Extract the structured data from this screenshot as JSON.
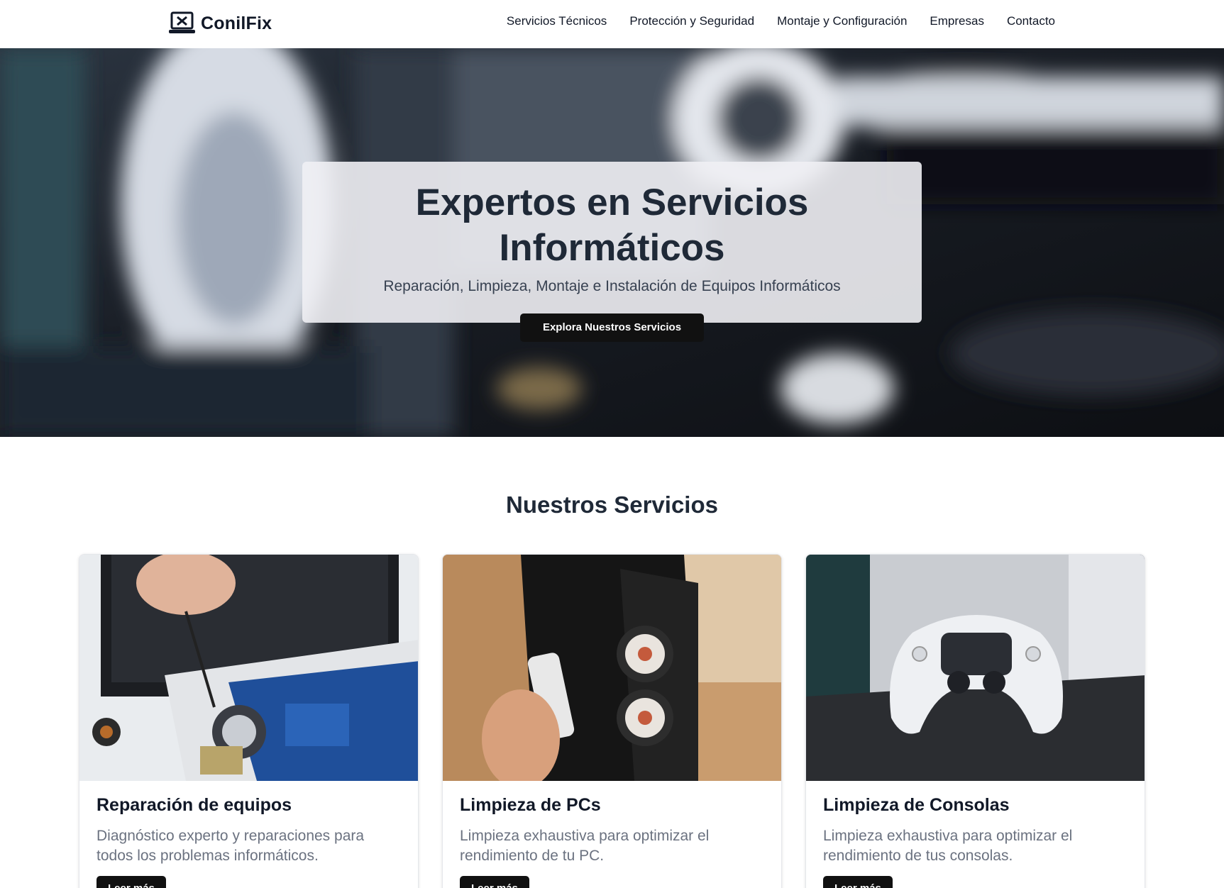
{
  "header": {
    "brand": "ConilFix",
    "brand_icon": "laptop-icon",
    "nav": [
      {
        "label": "Servicios Técnicos"
      },
      {
        "label": "Protección y Seguridad"
      },
      {
        "label": "Montaje y Configuración"
      },
      {
        "label": "Empresas"
      },
      {
        "label": "Contacto"
      }
    ]
  },
  "hero": {
    "title": "Expertos en Servicios Informáticos",
    "subtitle": "Reparación, Limpieza, Montaje e Instalación de Equipos Informáticos",
    "cta": "Explora Nuestros Servicios"
  },
  "services": {
    "title": "Nuestros Servicios",
    "cards": [
      {
        "title": "Reparación de equipos",
        "text": "Diagnóstico experto y reparaciones para todos los problemas informáticos.",
        "button": "Leer más"
      },
      {
        "title": "Limpieza de PCs",
        "text": "Limpieza exhaustiva para optimizar el rendimiento de tu PC.",
        "button": "Leer más"
      },
      {
        "title": "Limpieza de Consolas",
        "text": "Limpieza exhaustiva para optimizar el rendimiento de tus consolas.",
        "button": "Leer más"
      }
    ]
  },
  "colors": {
    "primary_button": "#111111",
    "heading": "#1f2937",
    "muted_text": "#6b7280"
  }
}
